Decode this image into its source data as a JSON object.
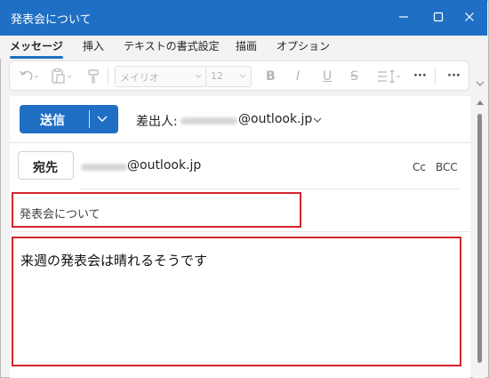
{
  "window": {
    "title": "発表会について",
    "accent": "#1f6fc5"
  },
  "ribbon": {
    "tabs": [
      {
        "label": "メッセージ",
        "active": true
      },
      {
        "label": "挿入"
      },
      {
        "label": "テキストの書式設定"
      },
      {
        "label": "描画"
      },
      {
        "label": "オプション"
      }
    ]
  },
  "toolbar": {
    "font_name": "メイリオ",
    "font_size": "12",
    "icons": [
      "undo-icon",
      "paste-icon",
      "format-painter-icon",
      "bold-icon",
      "italic-icon",
      "underline-icon",
      "strikethrough-icon",
      "paragraph-spacing-icon",
      "more-icon"
    ],
    "bold": "B",
    "italic": "I",
    "underline": "U",
    "strike": "S",
    "more": "···"
  },
  "compose": {
    "send_label": "送信",
    "from_label": "差出人:",
    "from_email": "@outlook.jp",
    "to_label": "宛先",
    "to_email": "@outlook.jp",
    "cc_label": "Cc",
    "bcc_label": "BCC",
    "subject": "発表会について",
    "body": "来週の発表会は晴れるそうです",
    "highlight_color": "#d3242d"
  }
}
